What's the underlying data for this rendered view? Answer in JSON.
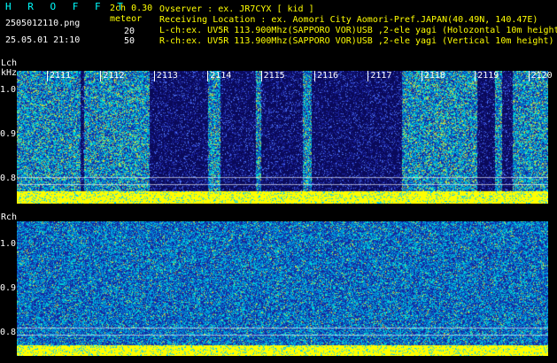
{
  "header": {
    "app_title": "H R O F F T",
    "filename": "2505012110.png",
    "datetime": "25.05.01 21:10",
    "version": "2ch 0.30",
    "mode": "meteor",
    "value_top": "20",
    "value_bottom": "50",
    "observer": "Ovserver            : ex. JR7CYX [ kid ]",
    "location": "Receiving Location : ex. Aomori City Aomori-Pref.JAPAN(40.49N, 140.47E)",
    "lch_info": "L-ch:ex. UV5R 113.900Mhz(SAPPORO VOR)USB ,2-ele yagi (Holozontal 10m height)",
    "rch_info": "R-ch:ex. UV5R 113.900Mhz(SAPPORO VOR)USB ,2-ele yagi (Vertical 10m height)"
  },
  "lch": {
    "label": "Lch",
    "unit": "kHz",
    "ticks": [
      "1.0",
      "0.9",
      "0.8"
    ],
    "time_labels": [
      "2111",
      "2112",
      "2113",
      "2114",
      "2115",
      "2116",
      "2117",
      "2118",
      "2119",
      "2120"
    ]
  },
  "rch": {
    "label": "Rch",
    "ticks": [
      "1.0",
      "0.9",
      "0.8"
    ]
  },
  "colors": {
    "background": "#000000",
    "text_yellow": "#ffff00",
    "text_cyan": "#00ffff",
    "text_white": "#ffffff",
    "noise_band": "#ffff00"
  }
}
